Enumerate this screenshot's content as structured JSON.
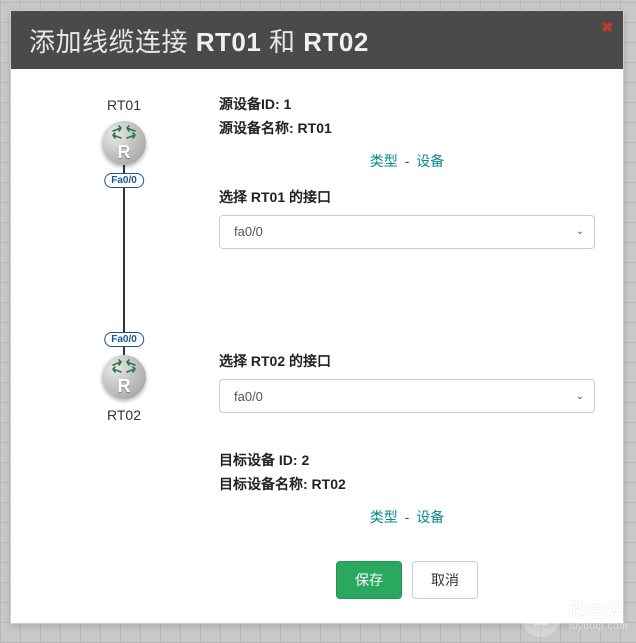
{
  "header": {
    "title_prefix": "添加线缆连接 ",
    "dev1": "RT01",
    "mid": " 和 ",
    "dev2": "RT02"
  },
  "diagram": {
    "top_label": "RT01",
    "port_top": "Fa0/0",
    "port_bottom": "Fa0/0",
    "bottom_label": "RT02"
  },
  "source": {
    "id_label": "源设备ID: 1",
    "name_label": "源设备名称: RT01",
    "link_type": "类型",
    "link_device": "设备"
  },
  "select1": {
    "label": "选择 RT01 的接口",
    "value": "fa0/0"
  },
  "select2": {
    "label": "选择 RT02 的接口",
    "value": "fa0/0"
  },
  "target": {
    "id_label": "目标设备 ID: 2",
    "name_label": "目标设备名称: RT02",
    "link_type": "类型",
    "link_device": "设备"
  },
  "buttons": {
    "save": "保存",
    "cancel": "取消"
  },
  "watermark": {
    "zh": "路由器",
    "en": "luyouqi.com"
  }
}
